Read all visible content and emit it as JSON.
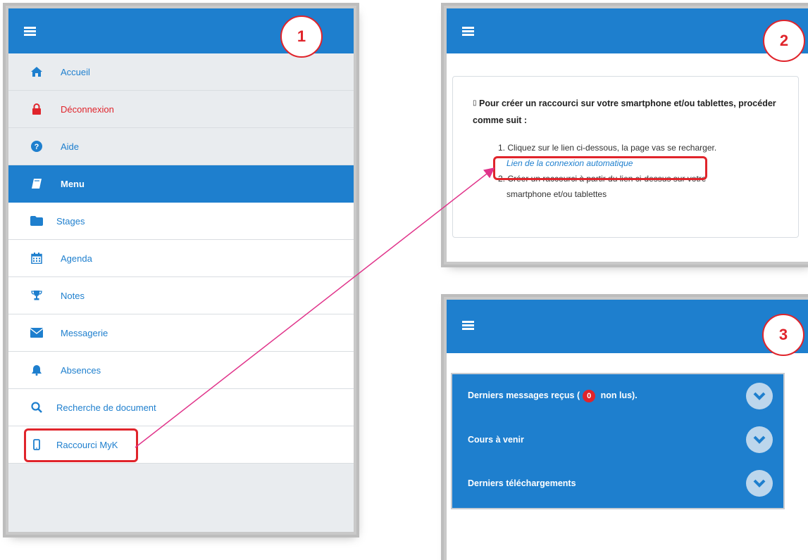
{
  "panel1": {
    "badge": "1",
    "items": [
      {
        "label": "Accueil",
        "icon": "home-icon"
      },
      {
        "label": "Déconnexion",
        "icon": "lock-icon"
      },
      {
        "label": "Aide",
        "icon": "question-circle-icon"
      },
      {
        "label": "Menu",
        "icon": "book-icon"
      },
      {
        "label": "Stages",
        "icon": "folder-icon"
      },
      {
        "label": "Agenda",
        "icon": "calendar-icon"
      },
      {
        "label": "Notes",
        "icon": "trophy-icon"
      },
      {
        "label": "Messagerie",
        "icon": "envelope-icon"
      },
      {
        "label": "Absences",
        "icon": "bell-icon"
      },
      {
        "label": "Recherche de document",
        "icon": "search-icon"
      },
      {
        "label": "Raccourci MyK",
        "icon": "mobile-icon"
      }
    ]
  },
  "panel2": {
    "badge": "2",
    "glyph": "▯",
    "intro": "Pour créer un raccourci sur votre smartphone et/ou tablettes, procéder comme suit :",
    "step1": "1. Cliquez sur le lien ci-dessous, la page vas se recharger.",
    "link": "Lien de la connexion automatique",
    "step2_line1": "2. Créer un raccourci à partir du lien ci-dessus sur votre",
    "step2_line2": "smartphone et/ou tablettes"
  },
  "panel3": {
    "badge": "3",
    "row1_prefix": "Derniers messages reçus (",
    "row1_count": "0",
    "row1_suffix": " non lus).",
    "row2": "Cours à venir",
    "row3": "Derniers téléchargements"
  },
  "colors": {
    "accent": "#1e7fce",
    "highlight": "#e0242b",
    "arrow": "#e0338a"
  }
}
